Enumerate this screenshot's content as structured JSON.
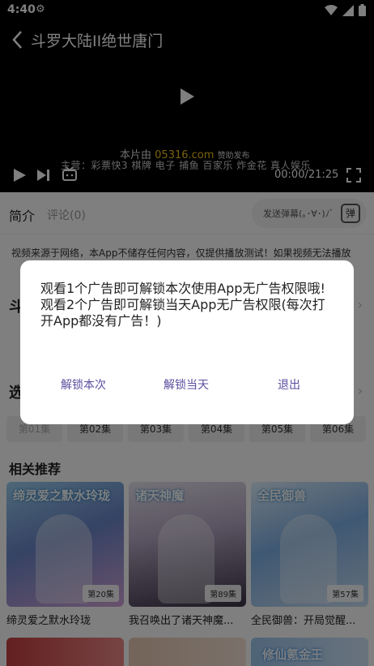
{
  "status_bar": {
    "time": "4:40"
  },
  "player": {
    "title": "斗罗大陆II绝世唐门",
    "sponsor_prefix": "本片由",
    "sponsor_site": "05316.com",
    "sponsor_suffix": "赞助发布",
    "ad_line": "主营：彩票快3 棋牌 电子 捕鱼 百家乐 炸金花 真人娱乐",
    "time_display": "00:00/21:25"
  },
  "tabs": {
    "intro": "简介",
    "comment": "评论(0)",
    "danmu_placeholder": "发送弹幕(｡･∀･)ﾉﾞ",
    "danmu_icon_label": "弹"
  },
  "notice": "视频来源于网络，本App不储存任何内容，仅提供播放测试！如果视频无法播放",
  "sections": {
    "title_char": "斗",
    "select_char": "选"
  },
  "episodes": [
    "第01集",
    "第02集",
    "第03集",
    "第04集",
    "第05集",
    "第06集"
  ],
  "related": {
    "title": "相关推荐",
    "items": [
      {
        "title": "缔灵爱之默水玲珑",
        "badge": "第20集",
        "poster_text": "缔灵爱之默水玲珑"
      },
      {
        "title": "我召唤出了诸天神魔...",
        "badge": "第89集",
        "poster_text": "诸天神魔"
      },
      {
        "title": "全民御兽：开局觉醒...",
        "badge": "第57集",
        "poster_text": "全民御兽"
      }
    ],
    "row2_texts": [
      "",
      "",
      "修仙氪金王"
    ]
  },
  "dialog": {
    "line1": "观看1个广告即可解锁本次使用App无广告权限哦!",
    "line2": "观看2个广告即可解锁当天App无广告权限(每次打开App都没有广告！)",
    "btn_once": "解锁本次",
    "btn_day": "解锁当天",
    "btn_exit": "退出"
  }
}
